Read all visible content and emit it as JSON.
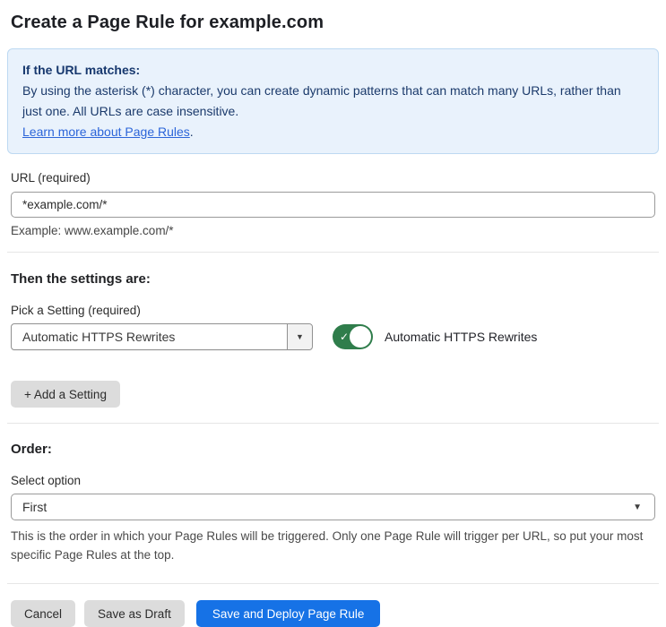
{
  "page": {
    "title": "Create a Page Rule for example.com"
  },
  "info_box": {
    "heading": "If the URL matches:",
    "body": "By using the asterisk (*) character, you can create dynamic patterns that can match many URLs, rather than just one. All URLs are case insensitive.",
    "link_label": "Learn more about Page Rules",
    "link_suffix": "."
  },
  "url_field": {
    "label": "URL (required)",
    "value": "*example.com/*",
    "hint": "Example: www.example.com/*"
  },
  "settings": {
    "heading": "Then the settings are:",
    "picker_label": "Pick a Setting (required)",
    "picker_value": "Automatic HTTPS Rewrites",
    "toggle_state": "on",
    "toggle_label": "Automatic HTTPS Rewrites",
    "add_button_label": "+ Add a Setting"
  },
  "order": {
    "heading": "Order:",
    "select_label": "Select option",
    "select_value": "First",
    "hint": "This is the order in which your Page Rules will be triggered. Only one Page Rule will trigger per URL, so put your most specific Page Rules at the top."
  },
  "actions": {
    "cancel_label": "Cancel",
    "save_draft_label": "Save as Draft",
    "save_deploy_label": "Save and Deploy Page Rule"
  },
  "icons": {
    "caret_down": "▼",
    "check": "✓"
  },
  "colors": {
    "info_bg": "#e9f2fc",
    "info_border": "#bdd9f2",
    "info_text": "#1b3a6b",
    "link_blue": "#2c65d9",
    "toggle_green": "#2f7d4b",
    "primary_blue": "#1672e6",
    "gray_button": "#dcdcdc"
  }
}
